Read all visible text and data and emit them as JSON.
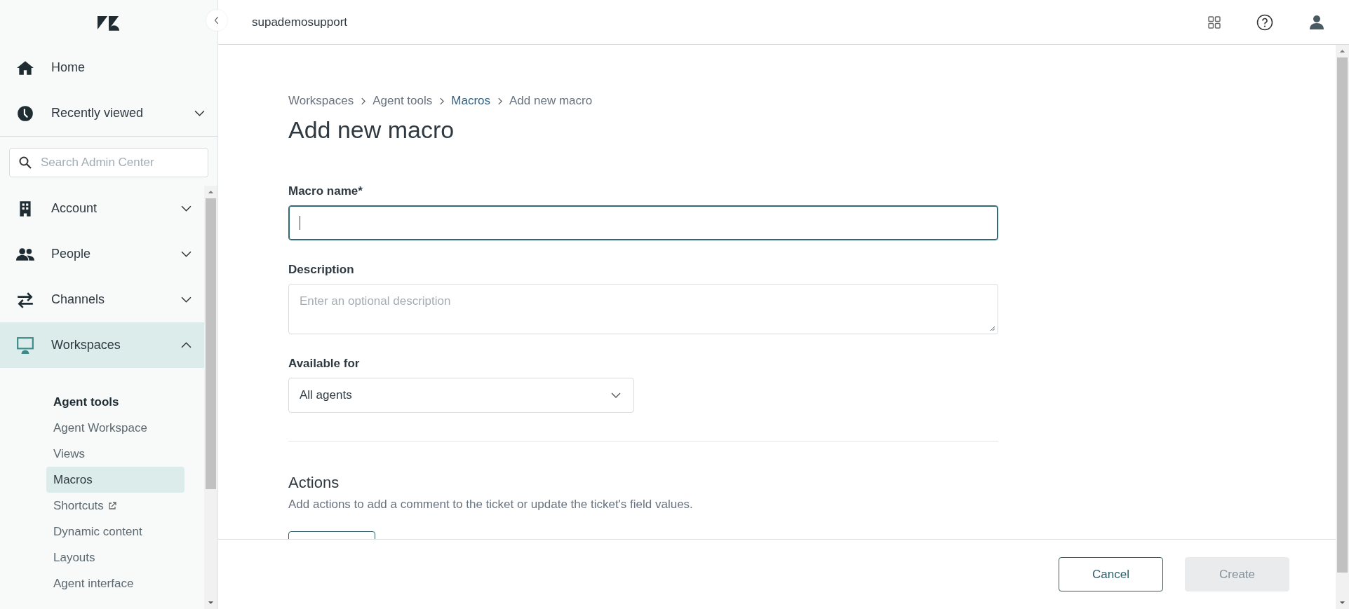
{
  "header": {
    "account": "supademosupport"
  },
  "sidebar": {
    "top_items": [
      {
        "label": "Home",
        "kind": "link"
      },
      {
        "label": "Recently viewed",
        "kind": "group",
        "expanded": false
      }
    ],
    "search": {
      "placeholder": "Search Admin Center"
    },
    "nav_items": [
      {
        "label": "Account",
        "expanded": false,
        "selected": false
      },
      {
        "label": "People",
        "expanded": false,
        "selected": false
      },
      {
        "label": "Channels",
        "expanded": false,
        "selected": false
      },
      {
        "label": "Workspaces",
        "expanded": true,
        "selected": true
      }
    ],
    "sub_items": [
      {
        "label": "Agent tools",
        "kind": "heading",
        "selected": false
      },
      {
        "label": "Agent Workspace",
        "kind": "link",
        "selected": false
      },
      {
        "label": "Views",
        "kind": "link",
        "selected": false
      },
      {
        "label": "Macros",
        "kind": "link",
        "selected": true
      },
      {
        "label": "Shortcuts",
        "kind": "external",
        "selected": false
      },
      {
        "label": "Dynamic content",
        "kind": "link",
        "selected": false
      },
      {
        "label": "Layouts",
        "kind": "link",
        "selected": false
      },
      {
        "label": "Agent interface",
        "kind": "link",
        "selected": false
      }
    ]
  },
  "breadcrumb": [
    {
      "label": "Workspaces",
      "kind": "text"
    },
    {
      "label": "Agent tools",
      "kind": "text"
    },
    {
      "label": "Macros",
      "kind": "link"
    },
    {
      "label": "Add new macro",
      "kind": "text"
    }
  ],
  "title": "Add new macro",
  "fields": [
    {
      "label": "Macro name*",
      "kind": "text",
      "focused": true
    },
    {
      "label": "Description",
      "kind": "textarea",
      "placeholder": "Enter an optional description",
      "focused": false
    },
    {
      "label": "Available for",
      "kind": "select",
      "value": "All agents",
      "focused": false
    }
  ],
  "actions": {
    "title": "Actions",
    "description": "Add actions to add a comment to the ticket or update the ticket's field values."
  },
  "footer_buttons": [
    {
      "label": "Cancel",
      "disabled": false
    },
    {
      "label": "Create",
      "disabled": true
    }
  ]
}
